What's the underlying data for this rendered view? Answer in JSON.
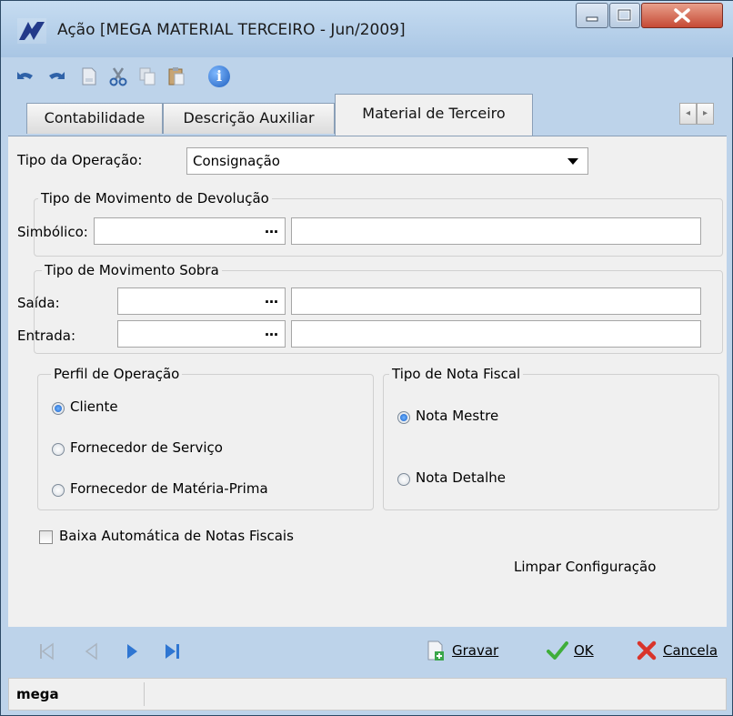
{
  "window": {
    "title": "Ação [MEGA MATERIAL TERCEIRO - Jun/2009]",
    "controls": {
      "minimize": "minimize",
      "maximize": "maximize",
      "close": "close"
    }
  },
  "toolbar": {
    "icons": [
      "undo-icon",
      "redo-icon",
      "new-document-icon",
      "cut-icon",
      "copy-icon",
      "paste-icon",
      "info-icon"
    ],
    "info_glyph": "i"
  },
  "tabs": [
    {
      "label": "Contabilidade",
      "active": false
    },
    {
      "label": "Descrição Auxiliar",
      "active": false
    },
    {
      "label": "Material de Terceiro",
      "active": true
    }
  ],
  "tab_scroll": {
    "left": "◂",
    "right": "▸"
  },
  "form": {
    "tipo_operacao": {
      "label": "Tipo da Operação:",
      "value": "Consignação"
    },
    "devolucao": {
      "title": "Tipo de Movimento de Devolução",
      "simbolico": {
        "label": "Simbólico:",
        "code": "",
        "description": "",
        "button": "…"
      }
    },
    "sobra": {
      "title": "Tipo de Movimento Sobra",
      "saida": {
        "label": "Saída:",
        "code": "",
        "description": "",
        "button": "…"
      },
      "entrada": {
        "label": "Entrada:",
        "code": "",
        "description": "",
        "button": "…"
      }
    },
    "perfil": {
      "title": "Perfil de Operação",
      "options": [
        {
          "label": "Cliente",
          "selected": true
        },
        {
          "label": "Fornecedor de Serviço",
          "selected": false
        },
        {
          "label": "Fornecedor de Matéria-Prima",
          "selected": false
        }
      ]
    },
    "nota_fiscal": {
      "title": "Tipo de Nota Fiscal",
      "options": [
        {
          "label": "Nota Mestre",
          "selected": true
        },
        {
          "label": "Nota Detalhe",
          "selected": false
        }
      ]
    },
    "baixa_automatica": {
      "label": "Baixa Automática de Notas Fiscais",
      "checked": false
    },
    "limpar": "Limpar Configuração"
  },
  "footer": {
    "nav": [
      "first-record-icon",
      "previous-record-icon",
      "next-record-icon",
      "last-record-icon"
    ],
    "gravar": "Gravar",
    "ok": "OK",
    "cancela": "Cancela"
  },
  "status": {
    "user": "mega"
  }
}
